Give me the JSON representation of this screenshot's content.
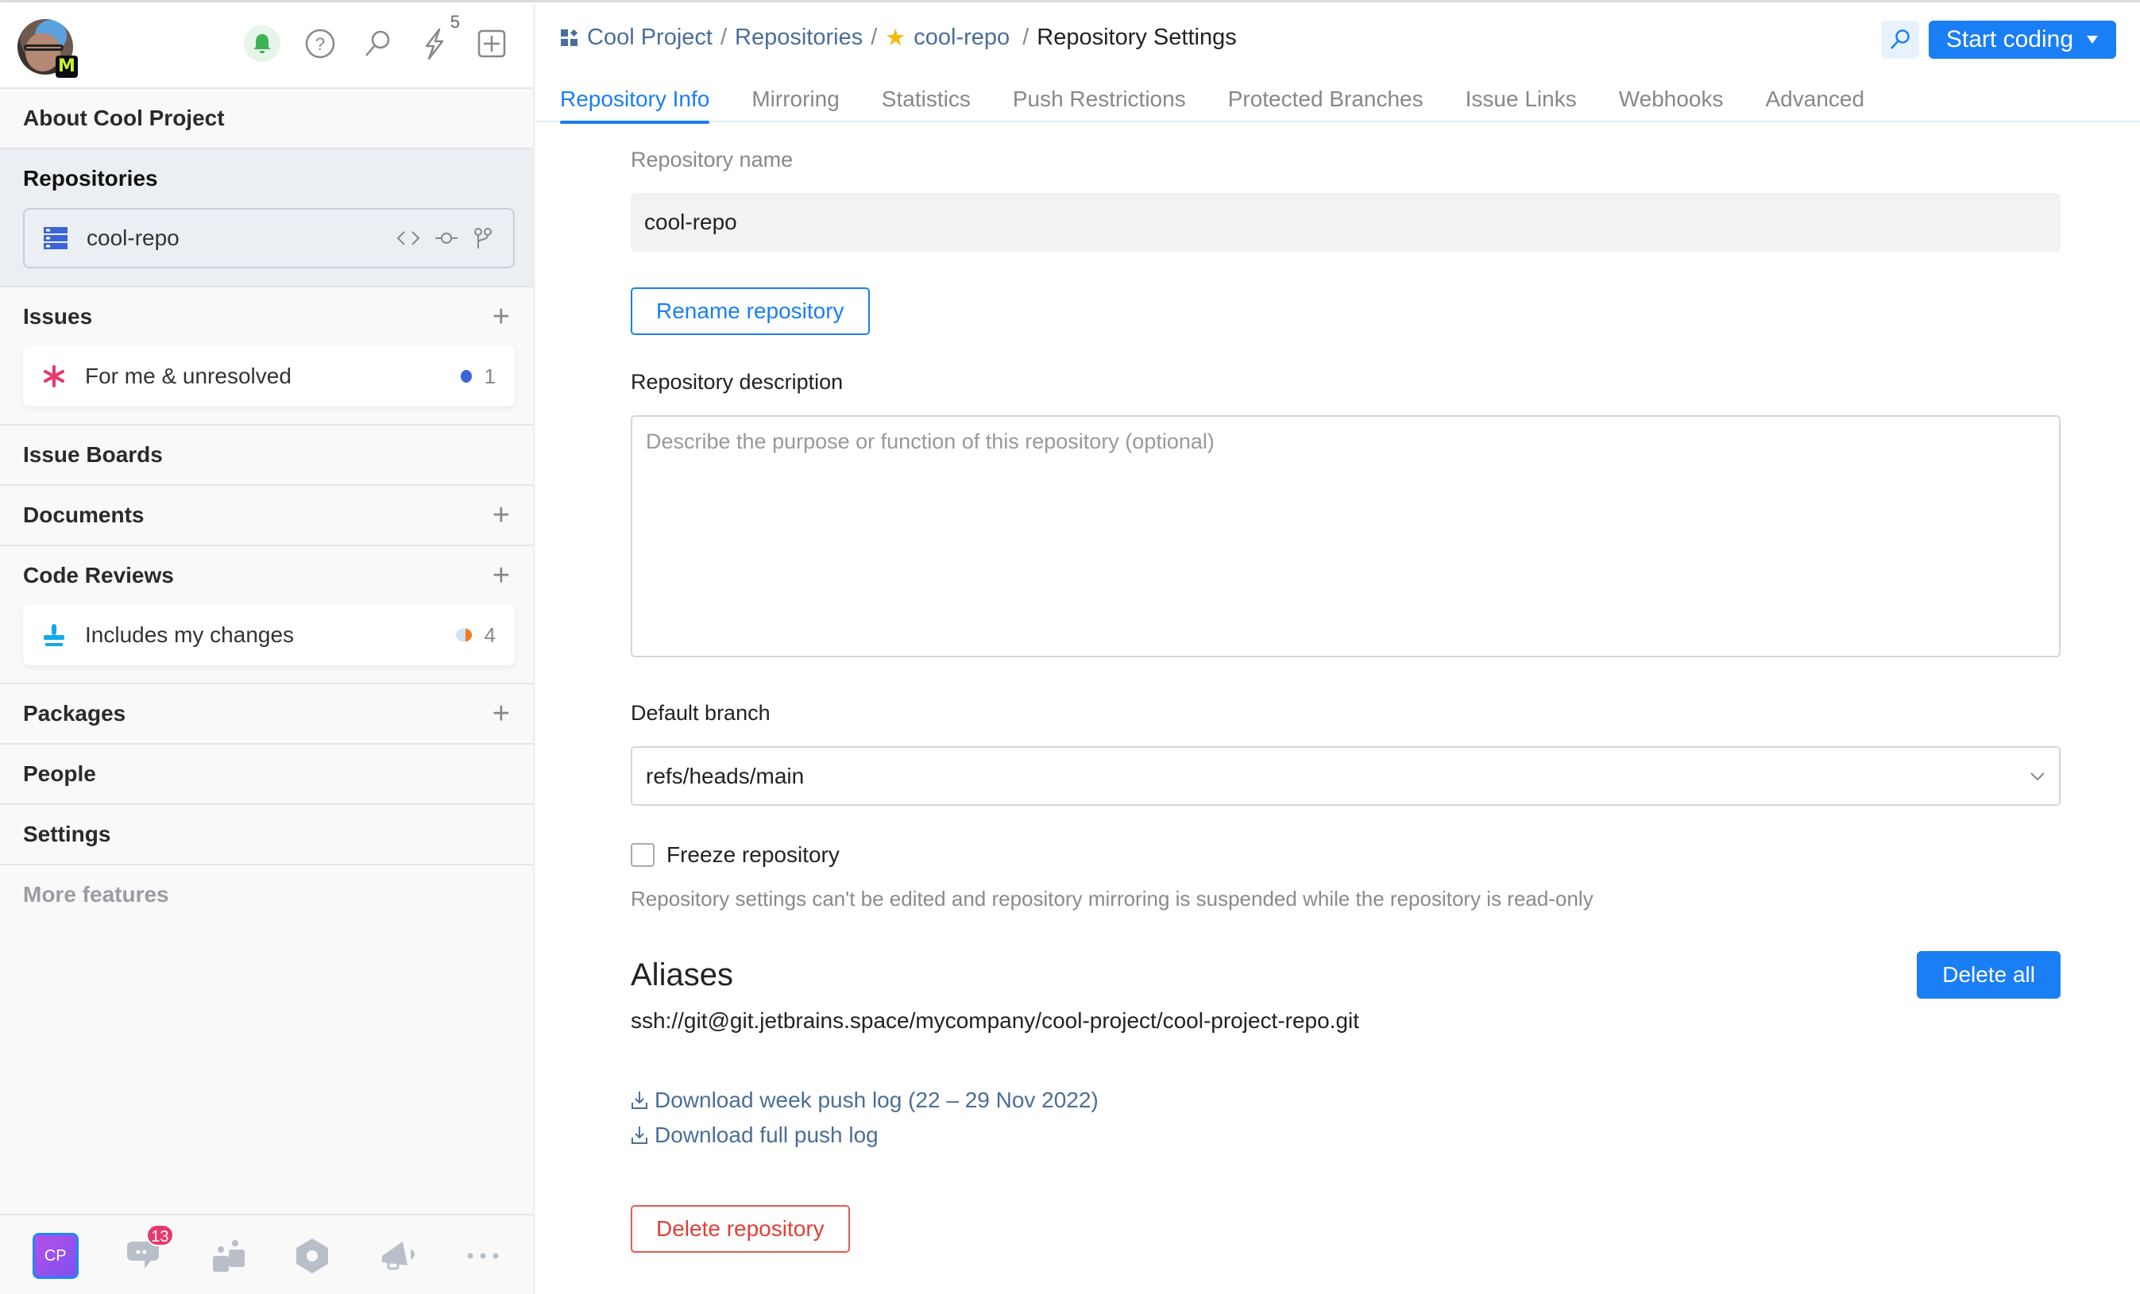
{
  "sidebar": {
    "notifications_count": "5",
    "user_badge": "M",
    "sections": {
      "about": "About Cool Project",
      "repositories": "Repositories",
      "issues": "Issues",
      "issue_boards": "Issue Boards",
      "documents": "Documents",
      "code_reviews": "Code Reviews",
      "packages": "Packages",
      "people": "People",
      "settings": "Settings",
      "more_features": "More features"
    },
    "repo_item": {
      "label": "cool-repo",
      "icon": "repository-icon"
    },
    "issues_item": {
      "label": "For me & unresolved",
      "count": "1"
    },
    "reviews_item": {
      "label": "Includes my changes",
      "count": "4"
    },
    "bottom": {
      "project_badge": "CP",
      "chat_badge": "13"
    }
  },
  "header": {
    "breadcrumb": [
      "Cool Project",
      "Repositories",
      "cool-repo",
      "Repository Settings"
    ],
    "start_coding": "Start coding"
  },
  "tabs": [
    "Repository Info",
    "Mirroring",
    "Statistics",
    "Push Restrictions",
    "Protected Branches",
    "Issue Links",
    "Webhooks",
    "Advanced"
  ],
  "active_tab": "Repository Info",
  "form": {
    "name_label": "Repository name",
    "name_value": "cool-repo",
    "rename_button": "Rename repository",
    "description_label": "Repository description",
    "description_placeholder": "Describe the purpose or function of this repository (optional)",
    "branch_label": "Default branch",
    "branch_value": "refs/heads/main",
    "freeze_label": "Freeze repository",
    "freeze_checked": false,
    "freeze_help": "Repository settings can't be edited and repository mirroring is suspended while the repository is read-only",
    "aliases_title": "Aliases",
    "delete_all_button": "Delete all",
    "alias_url": "ssh://git@git.jetbrains.space/mycompany/cool-project/cool-project-repo.git",
    "download_week": "Download week push log (22 – 29 Nov 2022)",
    "download_full": "Download full push log",
    "delete_repo_button": "Delete repository"
  },
  "colors": {
    "accent": "#1a7ef5",
    "link": "#4a6e9a",
    "danger": "#e04036",
    "badge": "#e8376b",
    "star": "#f5b90b"
  }
}
